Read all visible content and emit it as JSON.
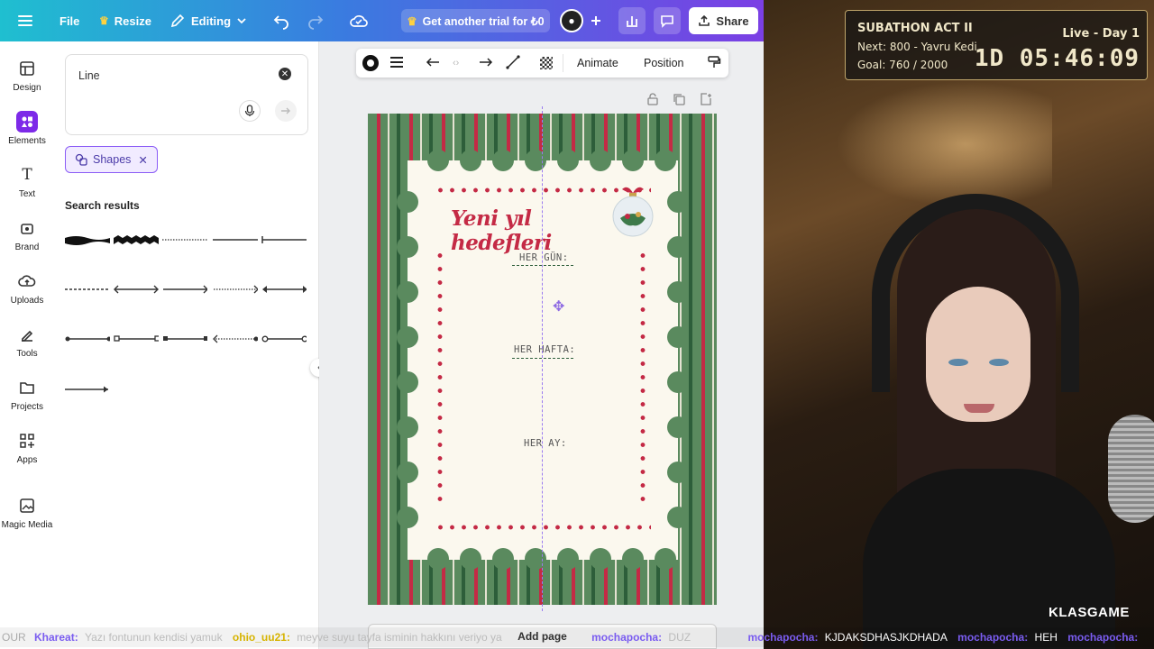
{
  "topbar": {
    "file": "File",
    "resize": "Resize",
    "editing": "Editing",
    "trial": "Get another trial for ₺0",
    "share": "Share"
  },
  "rail": [
    {
      "label": "Design",
      "icon": "design-icon"
    },
    {
      "label": "Elements",
      "icon": "elements-icon"
    },
    {
      "label": "Text",
      "icon": "text-icon"
    },
    {
      "label": "Brand",
      "icon": "brand-icon"
    },
    {
      "label": "Uploads",
      "icon": "uploads-icon"
    },
    {
      "label": "Tools",
      "icon": "tools-icon"
    },
    {
      "label": "Projects",
      "icon": "projects-icon"
    },
    {
      "label": "Apps",
      "icon": "apps-icon"
    },
    {
      "label": "Magic Media",
      "icon": "magic-media-icon"
    }
  ],
  "panel": {
    "search_value": "Line",
    "chip_label": "Shapes",
    "search_results": "Search results"
  },
  "toolbar": {
    "animate": "Animate",
    "position": "Position"
  },
  "canvas": {
    "heading": "Yeni yıl hedefleri",
    "label1": "HER GÜN:",
    "label2": "HER HAFTA:",
    "label3": "HER AY:",
    "add_page": "Add page"
  },
  "stream": {
    "title": "SUBATHON ACT II",
    "status": "Live - Day 1",
    "next": "Next: 800 - Yavru Kedi A",
    "goal": "Goal: 760 / 2000",
    "timer": "1D 05:46:09",
    "brand": "KLASGAME"
  },
  "chat": [
    {
      "user": "Khareat:",
      "msg": "Yazı fontunun kendisi yamuk",
      "color": "#7a5cf0"
    },
    {
      "user": "ohio_uu21:",
      "msg": "meyve suyu tayfa isminin hakkını veriyo ya",
      "color": "#d6b300"
    },
    {
      "user": "mochapocha:",
      "msg": "DUZ",
      "color": "#7a5cf0"
    },
    {
      "user": "mochapocha:",
      "msg": "KJDAKSDHASJKDHADA",
      "color": "#7a5cf0"
    },
    {
      "user": "mochapocha:",
      "msg": "HEH",
      "color": "#7a5cf0"
    },
    {
      "user": "mochapocha:",
      "msg": "",
      "color": "#7a5cf0"
    }
  ],
  "colors": {
    "accent": "#8b5cf6",
    "berry": "#c42a45",
    "pine": "#5a8a5e"
  }
}
